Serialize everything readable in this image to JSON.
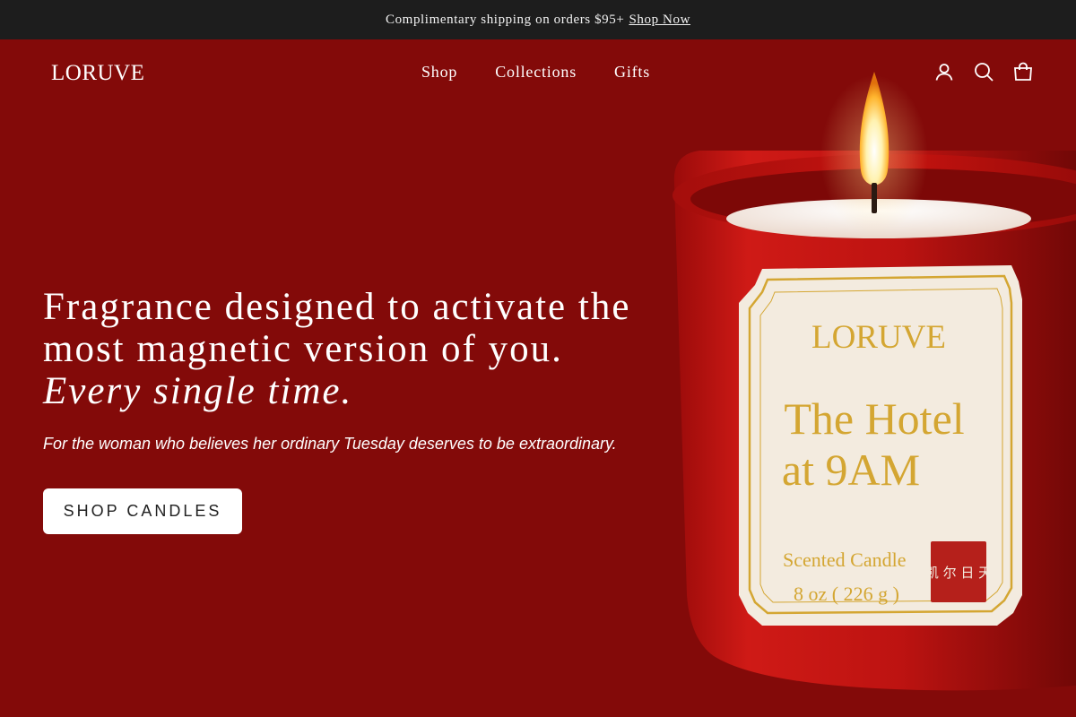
{
  "announcement": {
    "text": "Complimentary shipping on orders $95+",
    "link": "Shop Now"
  },
  "header": {
    "logo": "LORUVE",
    "nav": [
      "Shop",
      "Collections",
      "Gifts"
    ],
    "icons": [
      "account-icon",
      "search-icon",
      "cart-icon"
    ]
  },
  "hero": {
    "headline_main": "Fragrance designed to activate the most magnetic version of you.",
    "headline_italic": "Every single time.",
    "subheading": "For the woman who believes her ordinary Tuesday deserves to be extraordinary.",
    "cta": "SHOP CANDLES"
  },
  "product_label": {
    "brand": "LORUVE",
    "name_line1": "The Hotel",
    "name_line2": "at 9AM",
    "type": "Scented Candle",
    "size": "8 oz ( 226 g )",
    "seal": "凯 尔 日 天"
  },
  "colors": {
    "background": "#830a09",
    "announcement_bar": "#1d1d1d",
    "label_gold": "#d4a632",
    "jar_red": "#c11513"
  }
}
